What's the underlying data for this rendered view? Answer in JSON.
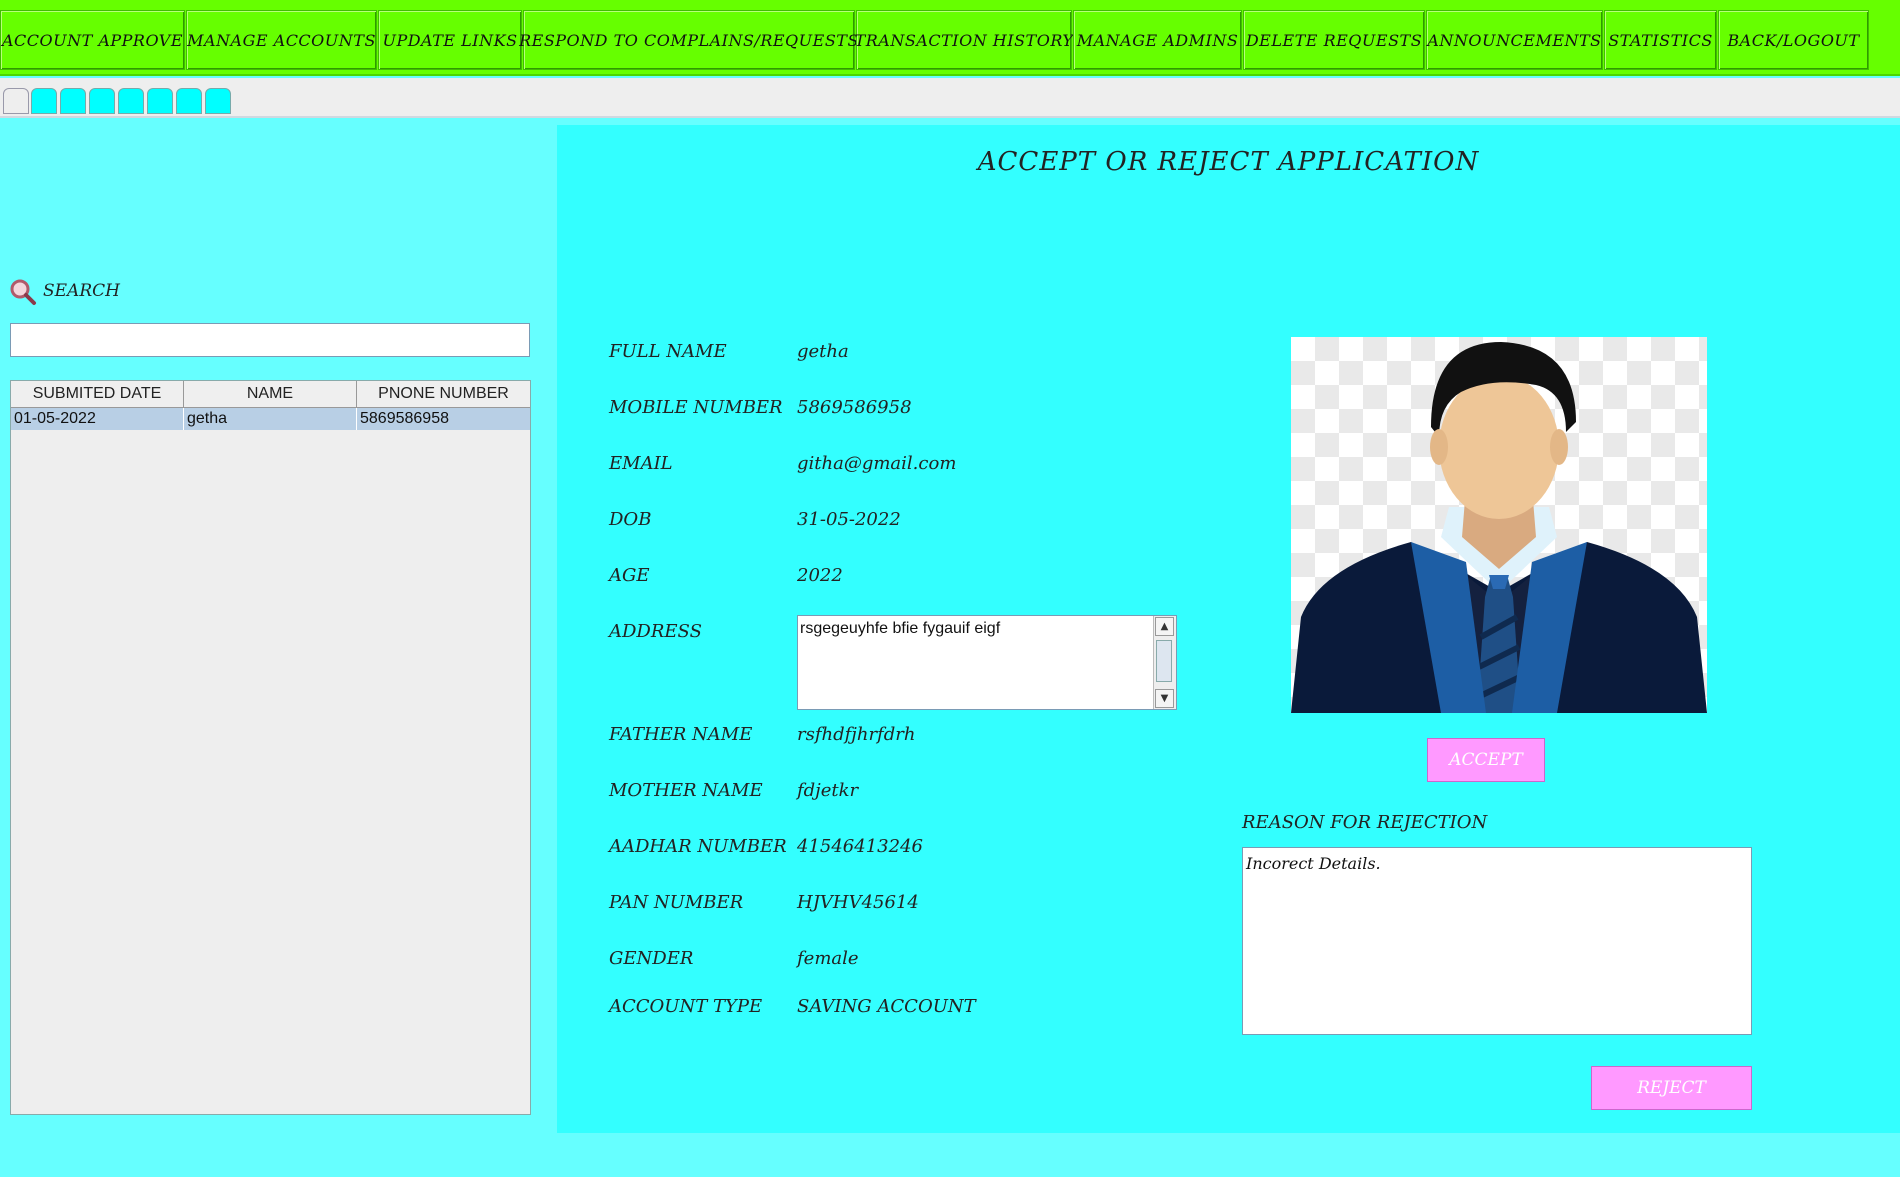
{
  "menu": {
    "items": [
      {
        "label": "ACCOUNT APPROVE"
      },
      {
        "label": "MANAGE ACCOUNTS"
      },
      {
        "label": "UPDATE LINKS"
      },
      {
        "label": "RESPOND TO COMPLAINS/REQUESTS"
      },
      {
        "label": "TRANSACTION HISTORY"
      },
      {
        "label": "MANAGE ADMINS"
      },
      {
        "label": "DELETE REQUESTS"
      },
      {
        "label": "ANNOUNCEMENTS"
      },
      {
        "label": "STATISTICS"
      },
      {
        "label": "BACK/LOGOUT"
      }
    ]
  },
  "search": {
    "label": "SEARCH",
    "value": ""
  },
  "table": {
    "headers": [
      "SUBMITED DATE",
      "NAME",
      "PNONE NUMBER"
    ],
    "rows": [
      [
        "01-05-2022",
        "getha",
        "5869586958"
      ]
    ]
  },
  "main": {
    "title": "ACCEPT OR REJECT APPLICATION",
    "fields": [
      {
        "label": "FULL NAME",
        "value": "getha"
      },
      {
        "label": "MOBILE NUMBER",
        "value": "5869586958"
      },
      {
        "label": "EMAIL",
        "value": "githa@gmail.com"
      },
      {
        "label": "DOB",
        "value": "31-05-2022"
      },
      {
        "label": "AGE",
        "value": "2022"
      },
      {
        "label": "ADDRESS",
        "value": "rsgegeuyhfe bfie fygauif eigf"
      },
      {
        "label": "FATHER NAME",
        "value": "rsfhdfjhrfdrh"
      },
      {
        "label": "MOTHER NAME",
        "value": "fdjetkr"
      },
      {
        "label": "AADHAR NUMBER",
        "value": "41546413246"
      },
      {
        "label": "PAN NUMBER",
        "value": "HJVHV45614"
      },
      {
        "label": "GENDER",
        "value": "female"
      },
      {
        "label": "ACCOUNT TYPE",
        "value": "SAVING ACCOUNT"
      }
    ],
    "accept_label": "ACCEPT",
    "reason_label": "REASON FOR REJECTION",
    "reason_value": "Incorect Details.",
    "reject_label": "REJECT"
  },
  "colors": {
    "menu_bg": "#66ff00",
    "page_bg": "#66ffff",
    "panel_bg": "#33ffff",
    "button_bg": "#ff99ff",
    "row_selected": "#b8cfe5"
  },
  "icons": {
    "search": "search-icon",
    "photo": "avatar-photo"
  }
}
